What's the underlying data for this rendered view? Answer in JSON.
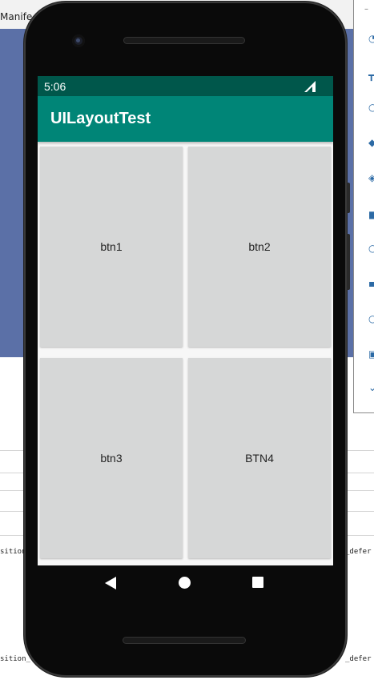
{
  "ide": {
    "tab_label": "Manife",
    "code_line_1_left": "sition_",
    "code_line_1_right": "_defer",
    "code_line_2_left": "sition_",
    "code_line_2_right": "_defer"
  },
  "status_bar": {
    "time": "5:06"
  },
  "app_bar": {
    "title": "UILayoutTest"
  },
  "buttons": [
    {
      "label": "btn1"
    },
    {
      "label": "btn2"
    },
    {
      "label": "btn3"
    },
    {
      "label": "BTN4"
    }
  ],
  "nav_bar": {
    "icons": [
      "back-icon",
      "home-icon",
      "recents-icon"
    ]
  },
  "colors": {
    "status_bar": "#00574b",
    "app_bar": "#008577",
    "button_bg": "#d6d7d7",
    "ide_blue": "#5b70a7"
  }
}
